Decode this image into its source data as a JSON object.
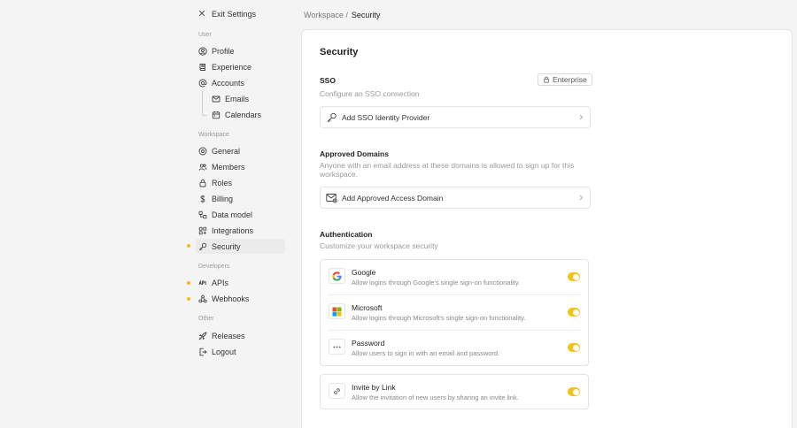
{
  "exit_label": "Exit Settings",
  "sidebar": {
    "user_label": "User",
    "user_items": [
      {
        "label": "Profile",
        "icon": "user-circle-icon"
      },
      {
        "label": "Experience",
        "icon": "book-icon"
      },
      {
        "label": "Accounts",
        "icon": "at-icon"
      },
      {
        "label": "Emails",
        "icon": "mail-icon"
      },
      {
        "label": "Calendars",
        "icon": "calendar-icon"
      }
    ],
    "workspace_label": "Workspace",
    "workspace_items": [
      {
        "label": "General",
        "icon": "gear-icon"
      },
      {
        "label": "Members",
        "icon": "users-icon"
      },
      {
        "label": "Roles",
        "icon": "lock-icon"
      },
      {
        "label": "Billing",
        "icon": "dollar-icon"
      },
      {
        "label": "Data model",
        "icon": "database-icon"
      },
      {
        "label": "Integrations",
        "icon": "apps-icon"
      },
      {
        "label": "Security",
        "icon": "key-icon"
      }
    ],
    "developers_label": "Developers",
    "developer_items": [
      {
        "label": "APIs",
        "icon": "api-icon"
      },
      {
        "label": "Webhooks",
        "icon": "webhook-icon"
      }
    ],
    "other_label": "Other",
    "other_items": [
      {
        "label": "Releases",
        "icon": "rocket-icon"
      },
      {
        "label": "Logout",
        "icon": "logout-icon"
      }
    ],
    "dot_color": "#f5bb1f"
  },
  "breadcrumb": {
    "workspace": "Workspace /",
    "current": "Security"
  },
  "main": {
    "title": "Security",
    "sso": {
      "heading": "SSO",
      "description": "Configure an SSO connection",
      "badge": "Enterprise",
      "add_label": "Add SSO Identity Provider"
    },
    "domains": {
      "heading": "Approved Domains",
      "description": "Anyone with an email address at these domains is allowed to sign up for this workspace.",
      "add_label": "Add Approved Access Domain"
    },
    "auth": {
      "heading": "Authentication",
      "description": "Customize your workspace security",
      "options": [
        {
          "title": "Google",
          "description": "Allow logins through Google's single sign-on functionality.",
          "enabled": true
        },
        {
          "title": "Microsoft",
          "description": "Allow logins through Microsoft's single sign-on functionality.",
          "enabled": true
        },
        {
          "title": "Password",
          "description": "Allow users to sign in with an email and password.",
          "enabled": true
        }
      ],
      "invite": {
        "title": "Invite by Link",
        "description": "Allow the invitation of new users by sharing an invite link.",
        "enabled": true
      }
    },
    "toggle_color": "#f2c21b"
  }
}
